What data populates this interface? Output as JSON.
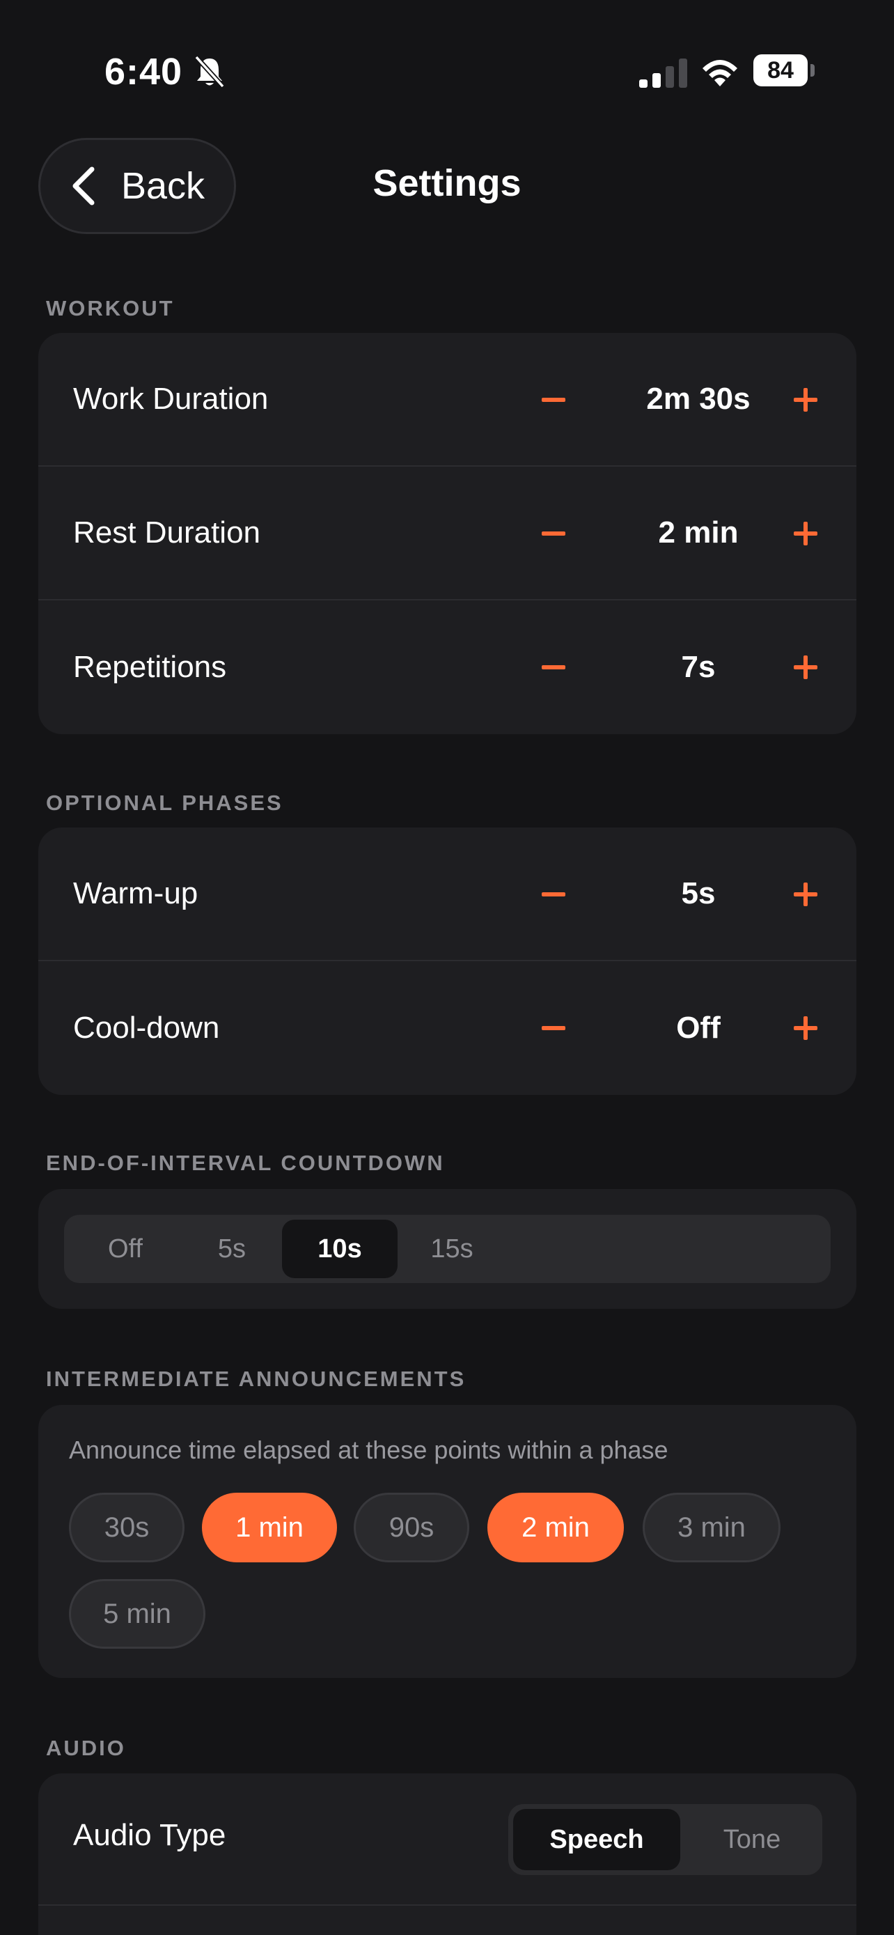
{
  "status_bar": {
    "time": "6:40",
    "battery": "84"
  },
  "header": {
    "back_label": "Back",
    "title": "Settings"
  },
  "sections": {
    "workout": "WORKOUT",
    "optional_phases": "OPTIONAL PHASES",
    "countdown": "END-OF-INTERVAL COUNTDOWN",
    "announcements": "INTERMEDIATE ANNOUNCEMENTS",
    "audio": "AUDIO"
  },
  "workout": {
    "work_duration": {
      "label": "Work Duration",
      "value": "2m 30s"
    },
    "rest_duration": {
      "label": "Rest Duration",
      "value": "2 min"
    },
    "repetitions": {
      "label": "Repetitions",
      "value": "7s"
    }
  },
  "optional_phases": {
    "warm_up": {
      "label": "Warm-up",
      "value": "5s"
    },
    "cool_down": {
      "label": "Cool-down",
      "value": "Off"
    }
  },
  "countdown": {
    "options": [
      "Off",
      "5s",
      "10s",
      "15s"
    ],
    "selected": "10s"
  },
  "announcements": {
    "description": "Announce time elapsed at these points within a phase",
    "chips": [
      "30s",
      "1 min",
      "90s",
      "2 min",
      "3 min",
      "5 min"
    ],
    "selected": [
      "1 min",
      "2 min"
    ]
  },
  "audio": {
    "audio_type_label": "Audio Type",
    "options": [
      "Speech",
      "Tone"
    ],
    "selected": "Speech"
  },
  "colors": {
    "accent": "#ff6a35",
    "background": "#141416",
    "card": "#1e1e21",
    "muted_text": "#8e8e93"
  }
}
